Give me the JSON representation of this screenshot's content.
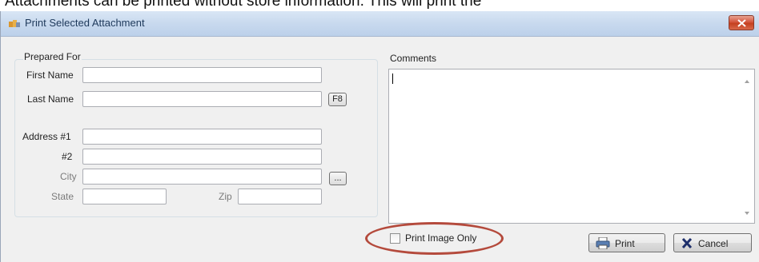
{
  "caption": "Attachments can be printed without store information. This will print the",
  "window": {
    "title": "Print Selected Attachment"
  },
  "prepared_for": {
    "legend": "Prepared For",
    "first_name_label": "First Name",
    "last_name_label": "Last Name",
    "lookup_button": "F8",
    "address1_label": "Address #1",
    "address2_label": "#2",
    "city_label": "City",
    "city_lookup_button": "...",
    "state_label": "State",
    "zip_label": "Zip",
    "first_name_value": "",
    "last_name_value": "",
    "address1_value": "",
    "address2_value": "",
    "city_value": "",
    "state_value": "",
    "zip_value": ""
  },
  "comments": {
    "label": "Comments",
    "value": ""
  },
  "options": {
    "print_image_only_label": "Print Image Only",
    "print_image_only_checked": false
  },
  "buttons": {
    "print": "Print",
    "cancel": "Cancel"
  },
  "colors": {
    "highlight_ring": "#b44a3c",
    "titlebar": "#c8d9ee",
    "close_button": "#c4401f"
  }
}
